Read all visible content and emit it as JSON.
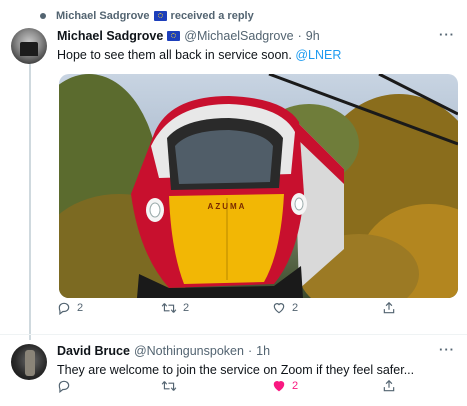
{
  "context": {
    "author": "Michael Sadgrove",
    "text": "received a reply"
  },
  "tweet": {
    "name": "Michael Sadgrove",
    "handle": "@MichaelSadgrove",
    "separator": "·",
    "time": "9h",
    "text": "Hope to see them all back in service soon. ",
    "mention": "@LNER",
    "media_label": "AZUMA",
    "actions": {
      "replies": "2",
      "retweets": "2",
      "likes": "2"
    }
  },
  "reply": {
    "name": "David Bruce",
    "handle": "@Nothingunspoken",
    "separator": "·",
    "time": "1h",
    "text": "They are welcome to join the service on Zoom if they feel safer...",
    "actions": {
      "replies": "",
      "retweets": "",
      "likes": "2",
      "liked": true
    }
  },
  "colors": {
    "accent": "#1d9bf0",
    "like": "#f91880",
    "secondary_text": "#536471",
    "train_red": "#c8102e",
    "train_yellow": "#f2b705"
  },
  "icons": {
    "reply": "speech-bubble-icon",
    "retweet": "retweet-icon",
    "like": "heart-icon",
    "share": "share-icon",
    "more": "more-horizontal-icon"
  }
}
